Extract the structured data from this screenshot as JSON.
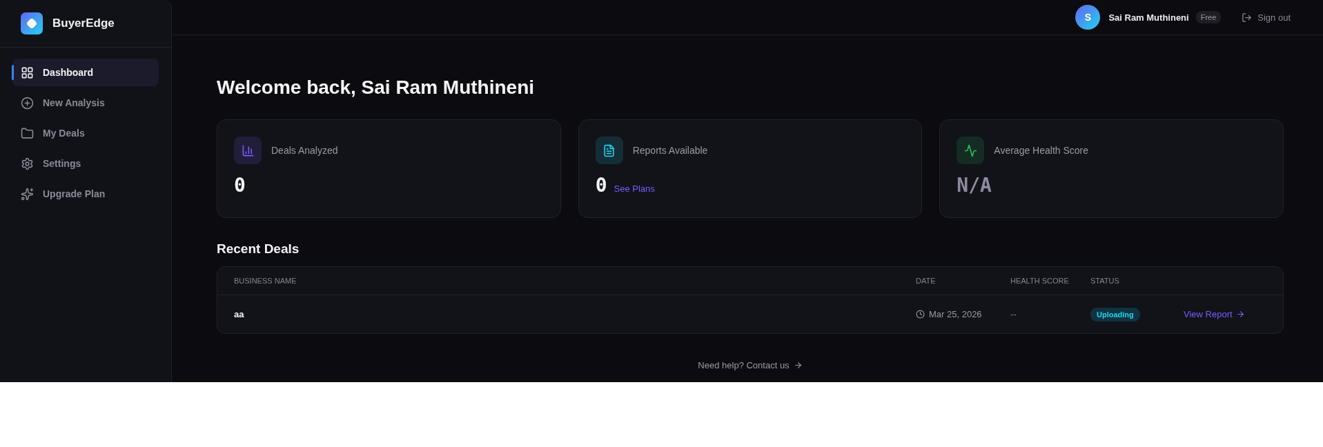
{
  "brand": {
    "name": "BuyerEdge"
  },
  "sidebar": {
    "items": [
      {
        "label": "Dashboard",
        "selected": true
      },
      {
        "label": "New Analysis",
        "selected": false
      },
      {
        "label": "My Deals",
        "selected": false
      },
      {
        "label": "Settings",
        "selected": false
      },
      {
        "label": "Upgrade Plan",
        "selected": false
      }
    ]
  },
  "header": {
    "avatar_initial": "S",
    "user_name": "Sai Ram Muthineni",
    "plan_badge": "Free",
    "sign_out": "Sign out"
  },
  "title": "Welcome back, Sai Ram Muthineni",
  "stats": [
    {
      "label": "Deals Analyzed",
      "value": "0",
      "color": "#7c5cff"
    },
    {
      "label": "Reports Available",
      "value": "0",
      "link": "See Plans",
      "color": "#22d3ee"
    },
    {
      "label": "Average Health Score",
      "value": "N/A",
      "color": "#22c55e",
      "muted": true
    }
  ],
  "recent_deals": {
    "heading": "Recent Deals",
    "columns": [
      "BUSINESS NAME",
      "DATE",
      "HEALTH SCORE",
      "STATUS"
    ],
    "rows": [
      {
        "business_name": "aa",
        "date": "Mar 25, 2026",
        "health_score": "--",
        "status": "Uploading",
        "action": "View Report"
      }
    ]
  },
  "help": "Need help? Contact us"
}
